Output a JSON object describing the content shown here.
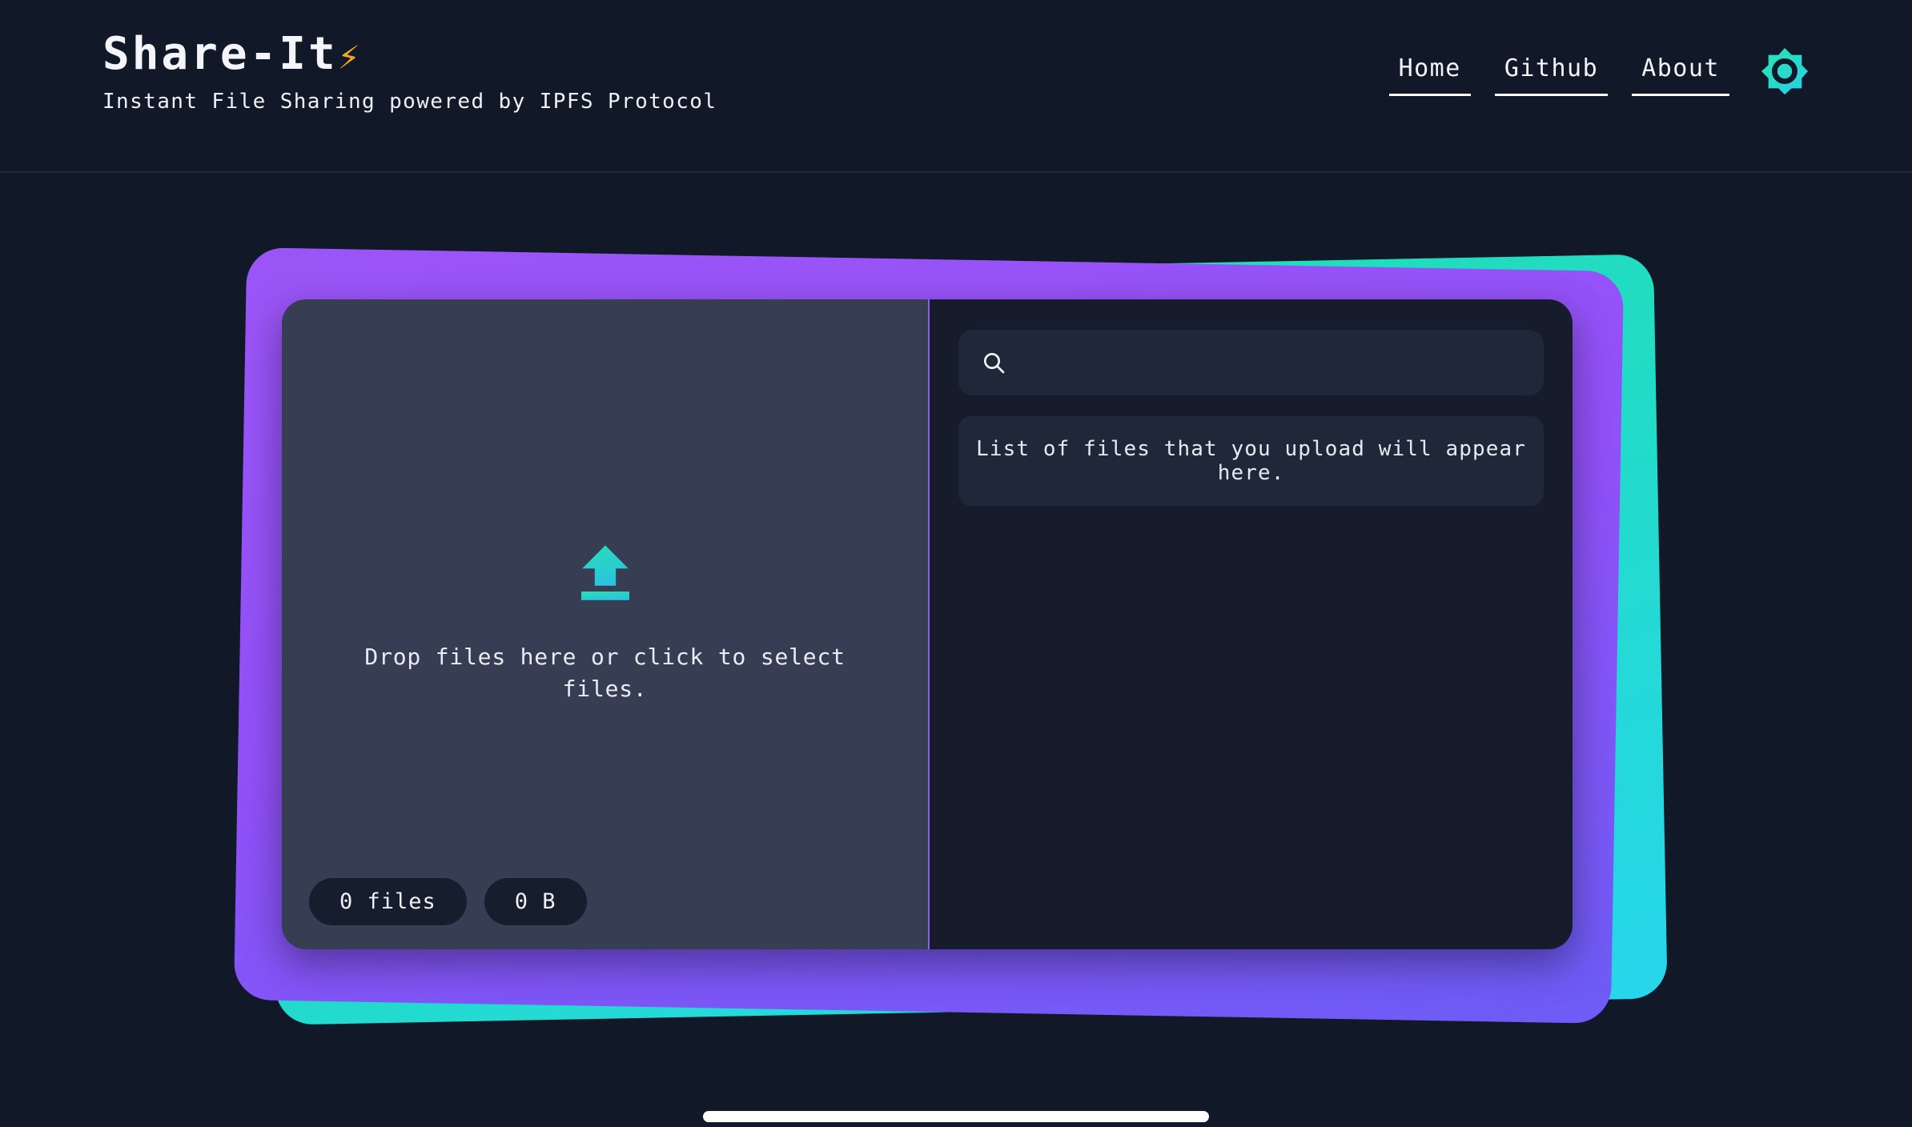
{
  "header": {
    "brand_title": "Share-It",
    "brand_bolt_icon": "high-voltage-icon",
    "brand_bolt": "⚡",
    "subtitle": "Instant File Sharing powered by IPFS Protocol",
    "nav": [
      {
        "label": "Home",
        "name": "nav-link-home"
      },
      {
        "label": "Github",
        "name": "nav-link-github"
      },
      {
        "label": "About",
        "name": "nav-link-about"
      }
    ],
    "theme_toggle_icon": "brightness-sun-icon"
  },
  "card": {
    "back_layer_color": "#1ee0b2",
    "back_layer_color_end": "#27d6ec",
    "front_layer_color": "#9b55f7",
    "front_layer_color_end": "#6c5cf5",
    "panel_color": "#373d52",
    "list_panel_color": "#161c2b"
  },
  "dropzone": {
    "icon": "upload-arrow-icon",
    "prompt": "Drop files here or click to select files.",
    "badges": [
      {
        "label": "0 files",
        "name": "file-count-badge"
      },
      {
        "label": "0 B",
        "name": "total-size-badge"
      }
    ]
  },
  "filelist": {
    "search_icon": "search-icon",
    "search_value": "",
    "search_placeholder": "",
    "empty_message": "List of files that you upload will appear here."
  },
  "scrollbar": {
    "orientation": "horizontal"
  }
}
